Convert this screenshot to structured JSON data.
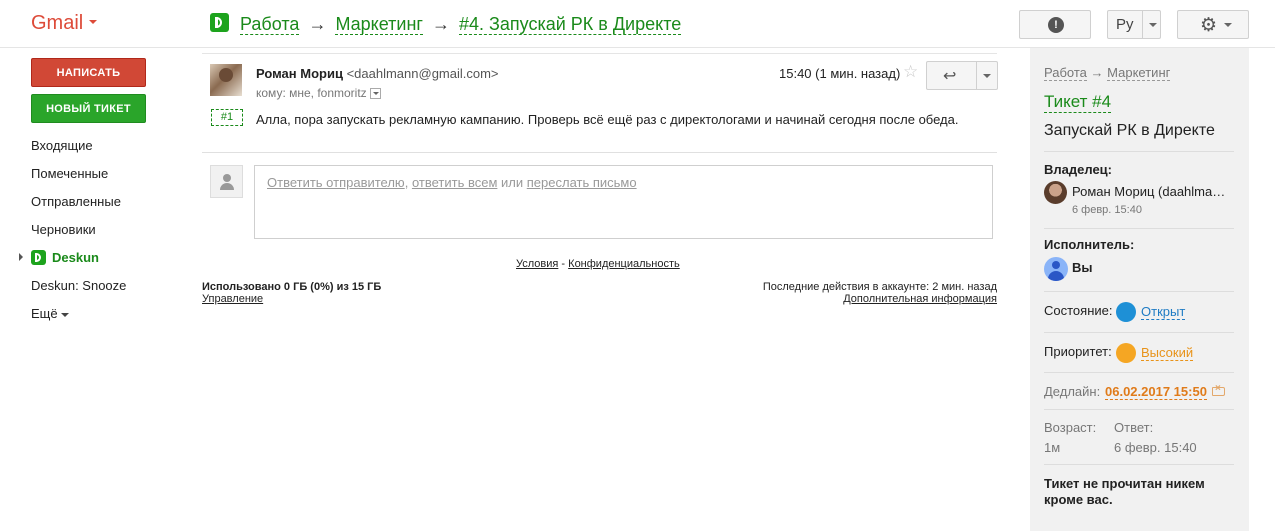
{
  "topbar": {
    "app_name": "Gmail",
    "breadcrumb": [
      "Работа",
      "Маркетинг",
      "#4. Запускай РК в Директе"
    ],
    "breadcrumb_sep": "→",
    "alert_label": "!",
    "lang": "Ру"
  },
  "sidebar": {
    "compose": "НАПИСАТЬ",
    "new_ticket": "НОВЫЙ ТИКЕТ",
    "items": [
      "Входящие",
      "Помеченные",
      "Отправленные",
      "Черновики",
      "Deskun",
      "Deskun: Snooze",
      "Ещё"
    ]
  },
  "message": {
    "sender_name": "Роман Мориц",
    "sender_email": "<daahlmann@gmail.com>",
    "to": "кому: мне, fonmoritz",
    "time": "15:40 (1 мин. назад)",
    "ticket_tag": "#1",
    "body": "Алла, пора запускать рекламную кампанию. Проверь всё ещё раз с директологами и начинай сегодня после обеда."
  },
  "reply": {
    "reply_sender": "Ответить отправителю",
    "comma": ",",
    "reply_all": "ответить всем",
    "or": "или",
    "forward": "переслать письмо"
  },
  "footer": {
    "terms": "Условия",
    "dash": "-",
    "privacy": "Конфиденциальность",
    "storage": "Использовано 0 ГБ (0%) из 15 ГБ",
    "manage": "Управление",
    "activity": "Последние действия в аккаунте: 2 мин. назад",
    "details": "Дополнительная информация"
  },
  "panel": {
    "crumb_work": "Работа",
    "crumb_sep": "→",
    "crumb_marketing": "Маркетинг",
    "ticket_title": "Тикет #4",
    "subject": "Запускай РК в Директе",
    "owner_label": "Владелец:",
    "owner_name": "Роман Мориц (daahlmann@gmail.com)",
    "owner_date": "6 февр. 15:40",
    "assignee_label": "Исполнитель:",
    "assignee_name": "Вы",
    "status_label": "Состояние:",
    "status_value": "Открыт",
    "priority_label": "Приоритет:",
    "priority_value": "Высокий",
    "deadline_label": "Дедлайн:",
    "deadline_value": "06.02.2017 15:50",
    "age_label": "Возраст:",
    "age_value": "1м",
    "answer_label": "Ответ:",
    "answer_value": "6 февр. 15:40",
    "unread_note": "Тикет не прочитан никем кроме вас."
  },
  "colors": {
    "brand_green": "#1a8a1a",
    "compose_red": "#d14836",
    "status_blue": "#1e90d6",
    "priority_orange": "#f5a623",
    "deadline_orange": "#e07b1a"
  },
  "icons": {
    "alert": "alert-icon",
    "settings": "gear-icon",
    "star": "star-icon",
    "reply": "reply-icon",
    "avatar_placeholder": "person-icon",
    "deadline_clear": "clear-icon"
  }
}
